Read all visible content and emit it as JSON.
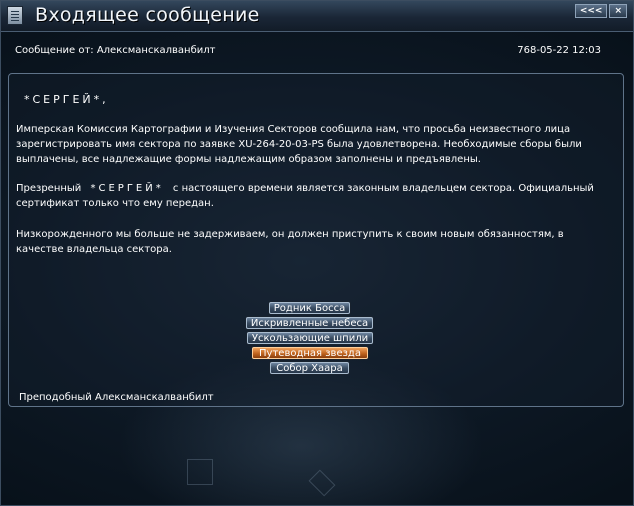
{
  "window": {
    "title": "Входящее сообщение",
    "controls": [
      "<<<",
      "×"
    ]
  },
  "header": {
    "from": "Сообщение от: Алексманскалванбилт",
    "datetime": "768-05-22  12:03"
  },
  "message": {
    "greeting": "*СЕРГЕЙ*,",
    "paragraph1": "Имперская Комиссия Картографии и Изучения Секторов сообщила нам, что просьба неизвестного лица зарегистрировать имя сектора по заявке XU-264-20-03-PS была удовлетворена. Необходимые сборы были выплачены, все надлежащие формы надлежащим образом заполнены и предъявлены.",
    "paragraph2_before": "Презренный",
    "paragraph2_name": "*СЕРГЕЙ*",
    "paragraph2_after": "с настоящего времени является законным владельцем сектора. Официальный сертификат только что ему передан.",
    "paragraph3": "Низкорожденного мы больше не задерживаем, он должен приступить к своим новым обязанностям, в качестве владельца сектора.",
    "signature": "Преподобный Алексманскалванбилт"
  },
  "choices": [
    {
      "label": "Родник Босса",
      "selected": false
    },
    {
      "label": "Искривленные небеса",
      "selected": false
    },
    {
      "label": "Ускользающие шпили",
      "selected": false
    },
    {
      "label": "Путеводная звезда",
      "selected": true
    },
    {
      "label": "Собор Хаара",
      "selected": false
    }
  ],
  "icons": {
    "title": "message-document-icon"
  }
}
